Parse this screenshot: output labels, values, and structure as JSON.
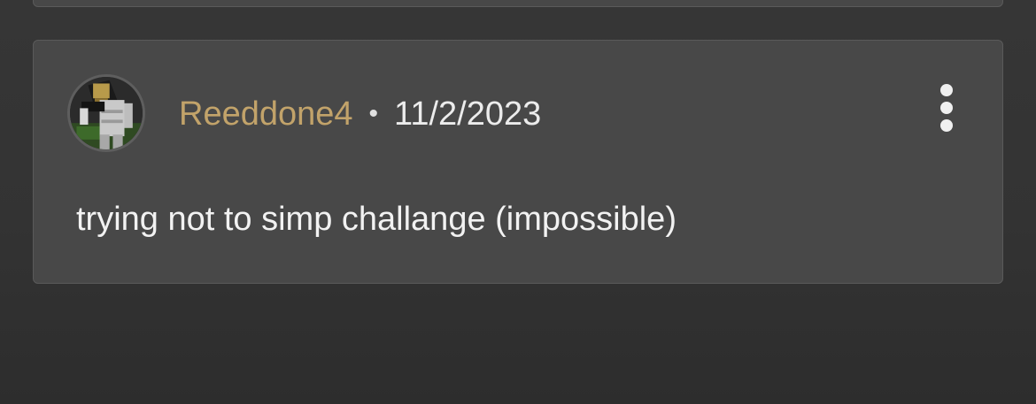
{
  "comment": {
    "username": "Reeddone4",
    "separator": "•",
    "date": "11/2/2023",
    "text": "trying not to simp challange (impossible)",
    "menu_icon": "more-vertical-icon"
  },
  "colors": {
    "background": "#333333",
    "card": "#484848",
    "username": "#c2a36a",
    "text": "#f2f2f2"
  }
}
